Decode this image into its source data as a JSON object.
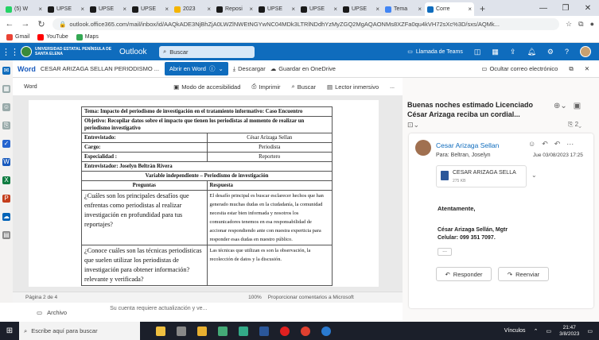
{
  "browser": {
    "tabs": [
      {
        "label": "(5) W",
        "color": "#25d366"
      },
      {
        "label": "UPSE",
        "color": "#1a1a1a"
      },
      {
        "label": "UPSE",
        "color": "#1a1a1a"
      },
      {
        "label": "UPSE",
        "color": "#1a1a1a"
      },
      {
        "label": "2023",
        "color": "#f4b400"
      },
      {
        "label": "Reposi",
        "color": "#1a1a1a"
      },
      {
        "label": "UPSE",
        "color": "#1a1a1a"
      },
      {
        "label": "UPSE",
        "color": "#1a1a1a"
      },
      {
        "label": "UPSE",
        "color": "#1a1a1a"
      },
      {
        "label": "Tema",
        "color": "#4285f4"
      },
      {
        "label": "Corre",
        "color": "#0f6cbd"
      }
    ],
    "new_tab": "+",
    "window_controls": {
      "minimize": "—",
      "maximize": "❐",
      "close": "✕"
    },
    "url": "outlook.office365.com/mail/inbox/id/AAQkADE3NjBhZjA0LWZlNWEtNGYwNC04MDk3LTRlNDdhYzMyZGQ2MgAQAONMs8XZFa0qu4kVH72sXc%3D/sxs/AQMk...",
    "bookmarks": [
      {
        "label": "Gmail",
        "icon": "gmail-icon"
      },
      {
        "label": "YouTube",
        "icon": "youtube-icon"
      },
      {
        "label": "Maps",
        "icon": "maps-icon"
      }
    ]
  },
  "outlook": {
    "university": "UNIVERSIDAD ESTATAL PENÍNSULA DE SANTA ELENA",
    "app_name": "Outlook",
    "search_placeholder": "Buscar",
    "teams_label": "Llamada de Teams",
    "brand_color": "#0f6cbd"
  },
  "word_viewer": {
    "app_label": "Word",
    "doc_name": "CESAR ARIZAGA SELLAN PERIODISMO ...",
    "open_in_word": "Abrir en Word",
    "download": "Descargar",
    "save_onedrive": "Guardar en OneDrive",
    "hide_email": "Ocultar correo electrónico",
    "doc_tool_left": "Word",
    "accessibility": "Modo de accesibilidad",
    "print": "Imprimir",
    "search": "Buscar",
    "immersive": "Lector inmersivo",
    "more": "...",
    "status_page": "Página 2 de 4",
    "status_zoom": "100%",
    "status_feedback": "Proporcionar comentarios a Microsoft"
  },
  "document_table": {
    "tema": "Tema: Impacto del periodismo de investigación en el tratamiento informativo: Caso Encuentro",
    "objetivo": "Objetivo: Recopilar datos sobre el impacto que tienen los periodistas al momento de realizar un periodismo investigativo",
    "rows": [
      {
        "label": "Entrevistado:",
        "value": "César Arizaga Sellan"
      },
      {
        "label": "Cargo:",
        "value": "Periodista"
      },
      {
        "label": "Especialidad :",
        "value": "Reportero"
      }
    ],
    "entrevistador": "Entrevistador: Joselyn Beltrán Rivera",
    "variable": "Variable independiente – Periodismo de investigación",
    "col_preguntas": "Preguntas",
    "col_respuesta": "Respuesta",
    "q1": "¿Cuáles son los principales desafíos que enfrentas como periodistas al realizar investigación en profundidad para tus reportajes?",
    "a1": "El desafío principal es buscar esclarecer hechos que han generado muchas dudas en la ciudadanía, la comunidad necesita estar bien informada y nosotros los comunicadores tenemos en esa responsabilidad de accionar respondiendo ante con nuestra experticia para responder esas dudas en nuestro público.",
    "q2": "¿Conoce cuáles son las técnicas periodísticas que suelen utilizar los periodistas de investigación para obtener información? relevante y verificada?",
    "a2": "Las técnicas que utilizan es son la observación, la recolección de datos y la discusión."
  },
  "attachment_bar": {
    "label": "Archivo",
    "note": "Su cuenta requiere actualización y ve..."
  },
  "message": {
    "subject": "Buenas noches estimado Licenciado César Arizaga reciba un cordial...",
    "sender": "Cesar Arizaga Sellan",
    "to": "Para: Beltran, Joselyn",
    "date": "Jue 03/08/2023 17:25",
    "attachment_name": "CESAR ARIZAGA SELLAN PER...",
    "attachment_size": "275 KB",
    "greeting": "Atentamente,",
    "signature_name": "César Arizaga Sellán, Mgtr",
    "signature_phone": "Celular: 099 351 7097.",
    "more_dots": "...",
    "reply": "Responder",
    "forward": "Reenviar",
    "count_badge": "2"
  },
  "taskbar": {
    "search_placeholder": "Escribe aquí para buscar",
    "weather": "Vínculos",
    "time": "21:47",
    "date": "3/8/2023"
  }
}
